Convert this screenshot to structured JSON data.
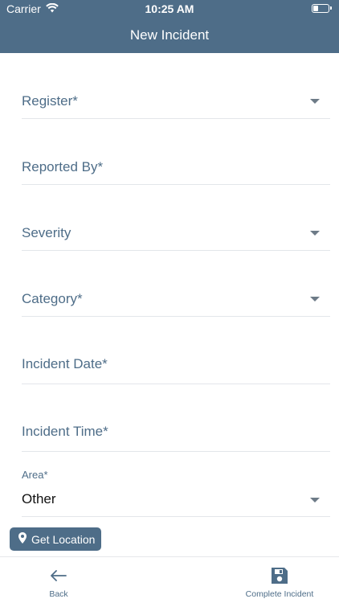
{
  "status_bar": {
    "carrier": "Carrier",
    "time": "10:25 AM",
    "battery_level": 0.35
  },
  "header": {
    "title": "New Incident"
  },
  "form": {
    "register_label": "Register*",
    "reported_by_label": "Reported By*",
    "severity_label": "Severity",
    "category_label": "Category*",
    "incident_date_label": "Incident Date*",
    "incident_time_label": "Incident Time*",
    "area_label": "Area*",
    "area_value": "Other",
    "get_location_label": "Get Location"
  },
  "bottom_bar": {
    "back_label": "Back",
    "complete_label": "Complete Incident"
  },
  "colors": {
    "brand": "#4e6d88",
    "divider": "#e3e6ea"
  },
  "icons": [
    "wifi-icon",
    "battery-icon",
    "dropdown-caret-icon",
    "location-pin-icon",
    "arrow-left-icon",
    "save-icon"
  ]
}
